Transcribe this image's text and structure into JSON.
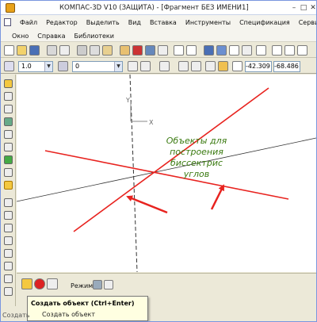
{
  "window": {
    "title": "КОМПАС-3D V10 (ЗАЩИТА) - [Фрагмент БЕЗ ИМЕНИ1]"
  },
  "menu": {
    "row1": [
      "Файл",
      "Редактор",
      "Выделить",
      "Вид",
      "Вставка",
      "Инструменты",
      "Спецификация",
      "Сервис"
    ],
    "row2": [
      "Окно",
      "Справка",
      "Библиотеки"
    ]
  },
  "toolbar": {
    "scale_value": "1.0",
    "layer_value": "0",
    "coord_x": "-42.309",
    "coord_y": "-68.486"
  },
  "canvas": {
    "axis_y_label": "Y",
    "axis_x_label": "X",
    "annotation": [
      "Объекты для",
      "построения",
      "биссектрис",
      "углов"
    ],
    "line_colors": {
      "red": "#e8231f",
      "black": "#333333"
    }
  },
  "bottom_panel": {
    "mode_label": "Режим"
  },
  "tooltip": {
    "title": "Создать объект (Ctrl+Enter)",
    "subtitle": "Создать объект"
  },
  "statusbar": {
    "text": "Создать"
  }
}
